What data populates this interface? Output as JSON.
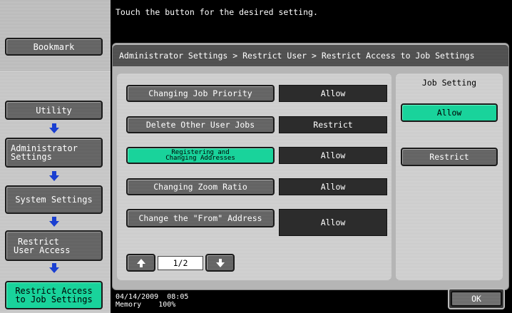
{
  "header": {
    "message": "Touch the button for the desired setting."
  },
  "sidebar": {
    "bookmark_label": "Bookmark",
    "items": [
      {
        "label": "Utility"
      },
      {
        "label_line1": "Administrator",
        "label_line2": "Settings"
      },
      {
        "label": "System Settings"
      },
      {
        "label_line1": "Restrict",
        "label_line2": "User Access"
      },
      {
        "label_line1": "Restrict Access",
        "label_line2": "to Job Settings"
      }
    ]
  },
  "breadcrumb": "Administrator Settings > Restrict User > Restrict Access to Job Settings",
  "settings": [
    {
      "label": "Changing Job Priority",
      "value": "Allow"
    },
    {
      "label": "Delete Other User Jobs",
      "value": "Restrict"
    },
    {
      "label_line1": "Registering and",
      "label_line2": "Changing Addresses",
      "value": "Allow"
    },
    {
      "label": "Changing Zoom Ratio",
      "value": "Allow"
    },
    {
      "label": "Change the \"From\" Address",
      "value": "Allow"
    }
  ],
  "pager": {
    "page": "1/2"
  },
  "job_setting": {
    "title": "Job Setting",
    "options": [
      "Allow",
      "Restrict"
    ],
    "selected": "Allow"
  },
  "footer": {
    "date": "04/14/2009",
    "time": "08:05",
    "memory_label": "Memory",
    "memory_value": "100%"
  },
  "ok_label": "OK",
  "colors": {
    "selected": "#19d39b",
    "panel": "#b5b5b5",
    "value_bg": "#2c2c2c"
  }
}
